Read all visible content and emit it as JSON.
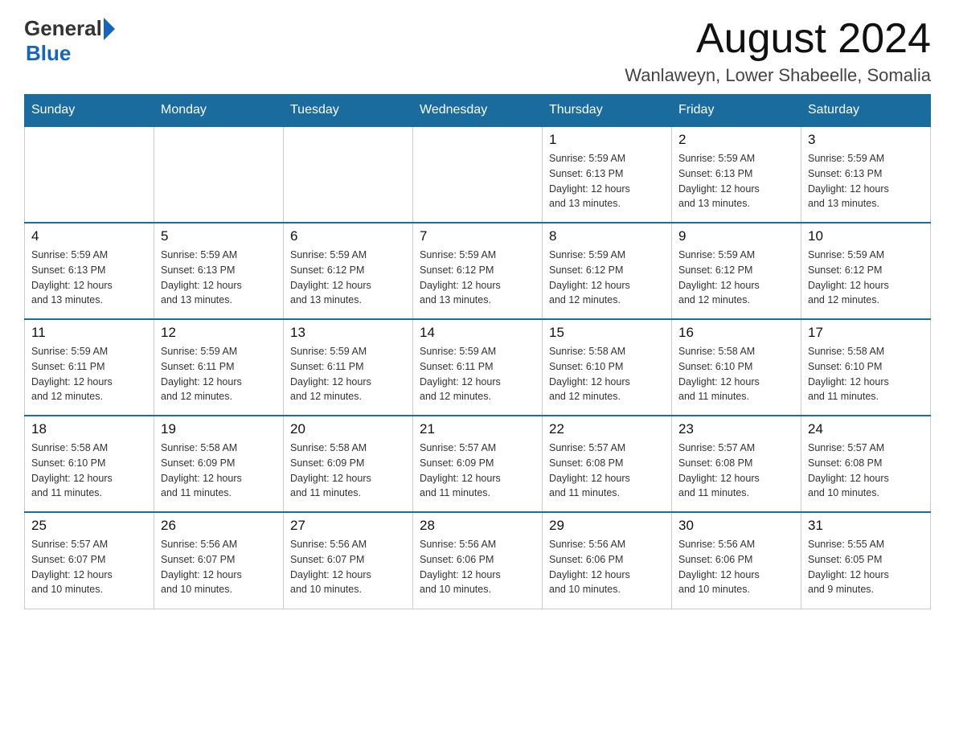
{
  "header": {
    "logo_general": "General",
    "logo_blue": "Blue",
    "month_title": "August 2024",
    "location": "Wanlaweyn, Lower Shabeelle, Somalia"
  },
  "weekdays": [
    "Sunday",
    "Monday",
    "Tuesday",
    "Wednesday",
    "Thursday",
    "Friday",
    "Saturday"
  ],
  "weeks": [
    [
      {
        "day": "",
        "info": ""
      },
      {
        "day": "",
        "info": ""
      },
      {
        "day": "",
        "info": ""
      },
      {
        "day": "",
        "info": ""
      },
      {
        "day": "1",
        "info": "Sunrise: 5:59 AM\nSunset: 6:13 PM\nDaylight: 12 hours\nand 13 minutes."
      },
      {
        "day": "2",
        "info": "Sunrise: 5:59 AM\nSunset: 6:13 PM\nDaylight: 12 hours\nand 13 minutes."
      },
      {
        "day": "3",
        "info": "Sunrise: 5:59 AM\nSunset: 6:13 PM\nDaylight: 12 hours\nand 13 minutes."
      }
    ],
    [
      {
        "day": "4",
        "info": "Sunrise: 5:59 AM\nSunset: 6:13 PM\nDaylight: 12 hours\nand 13 minutes."
      },
      {
        "day": "5",
        "info": "Sunrise: 5:59 AM\nSunset: 6:13 PM\nDaylight: 12 hours\nand 13 minutes."
      },
      {
        "day": "6",
        "info": "Sunrise: 5:59 AM\nSunset: 6:12 PM\nDaylight: 12 hours\nand 13 minutes."
      },
      {
        "day": "7",
        "info": "Sunrise: 5:59 AM\nSunset: 6:12 PM\nDaylight: 12 hours\nand 13 minutes."
      },
      {
        "day": "8",
        "info": "Sunrise: 5:59 AM\nSunset: 6:12 PM\nDaylight: 12 hours\nand 12 minutes."
      },
      {
        "day": "9",
        "info": "Sunrise: 5:59 AM\nSunset: 6:12 PM\nDaylight: 12 hours\nand 12 minutes."
      },
      {
        "day": "10",
        "info": "Sunrise: 5:59 AM\nSunset: 6:12 PM\nDaylight: 12 hours\nand 12 minutes."
      }
    ],
    [
      {
        "day": "11",
        "info": "Sunrise: 5:59 AM\nSunset: 6:11 PM\nDaylight: 12 hours\nand 12 minutes."
      },
      {
        "day": "12",
        "info": "Sunrise: 5:59 AM\nSunset: 6:11 PM\nDaylight: 12 hours\nand 12 minutes."
      },
      {
        "day": "13",
        "info": "Sunrise: 5:59 AM\nSunset: 6:11 PM\nDaylight: 12 hours\nand 12 minutes."
      },
      {
        "day": "14",
        "info": "Sunrise: 5:59 AM\nSunset: 6:11 PM\nDaylight: 12 hours\nand 12 minutes."
      },
      {
        "day": "15",
        "info": "Sunrise: 5:58 AM\nSunset: 6:10 PM\nDaylight: 12 hours\nand 12 minutes."
      },
      {
        "day": "16",
        "info": "Sunrise: 5:58 AM\nSunset: 6:10 PM\nDaylight: 12 hours\nand 11 minutes."
      },
      {
        "day": "17",
        "info": "Sunrise: 5:58 AM\nSunset: 6:10 PM\nDaylight: 12 hours\nand 11 minutes."
      }
    ],
    [
      {
        "day": "18",
        "info": "Sunrise: 5:58 AM\nSunset: 6:10 PM\nDaylight: 12 hours\nand 11 minutes."
      },
      {
        "day": "19",
        "info": "Sunrise: 5:58 AM\nSunset: 6:09 PM\nDaylight: 12 hours\nand 11 minutes."
      },
      {
        "day": "20",
        "info": "Sunrise: 5:58 AM\nSunset: 6:09 PM\nDaylight: 12 hours\nand 11 minutes."
      },
      {
        "day": "21",
        "info": "Sunrise: 5:57 AM\nSunset: 6:09 PM\nDaylight: 12 hours\nand 11 minutes."
      },
      {
        "day": "22",
        "info": "Sunrise: 5:57 AM\nSunset: 6:08 PM\nDaylight: 12 hours\nand 11 minutes."
      },
      {
        "day": "23",
        "info": "Sunrise: 5:57 AM\nSunset: 6:08 PM\nDaylight: 12 hours\nand 11 minutes."
      },
      {
        "day": "24",
        "info": "Sunrise: 5:57 AM\nSunset: 6:08 PM\nDaylight: 12 hours\nand 10 minutes."
      }
    ],
    [
      {
        "day": "25",
        "info": "Sunrise: 5:57 AM\nSunset: 6:07 PM\nDaylight: 12 hours\nand 10 minutes."
      },
      {
        "day": "26",
        "info": "Sunrise: 5:56 AM\nSunset: 6:07 PM\nDaylight: 12 hours\nand 10 minutes."
      },
      {
        "day": "27",
        "info": "Sunrise: 5:56 AM\nSunset: 6:07 PM\nDaylight: 12 hours\nand 10 minutes."
      },
      {
        "day": "28",
        "info": "Sunrise: 5:56 AM\nSunset: 6:06 PM\nDaylight: 12 hours\nand 10 minutes."
      },
      {
        "day": "29",
        "info": "Sunrise: 5:56 AM\nSunset: 6:06 PM\nDaylight: 12 hours\nand 10 minutes."
      },
      {
        "day": "30",
        "info": "Sunrise: 5:56 AM\nSunset: 6:06 PM\nDaylight: 12 hours\nand 10 minutes."
      },
      {
        "day": "31",
        "info": "Sunrise: 5:55 AM\nSunset: 6:05 PM\nDaylight: 12 hours\nand 9 minutes."
      }
    ]
  ]
}
